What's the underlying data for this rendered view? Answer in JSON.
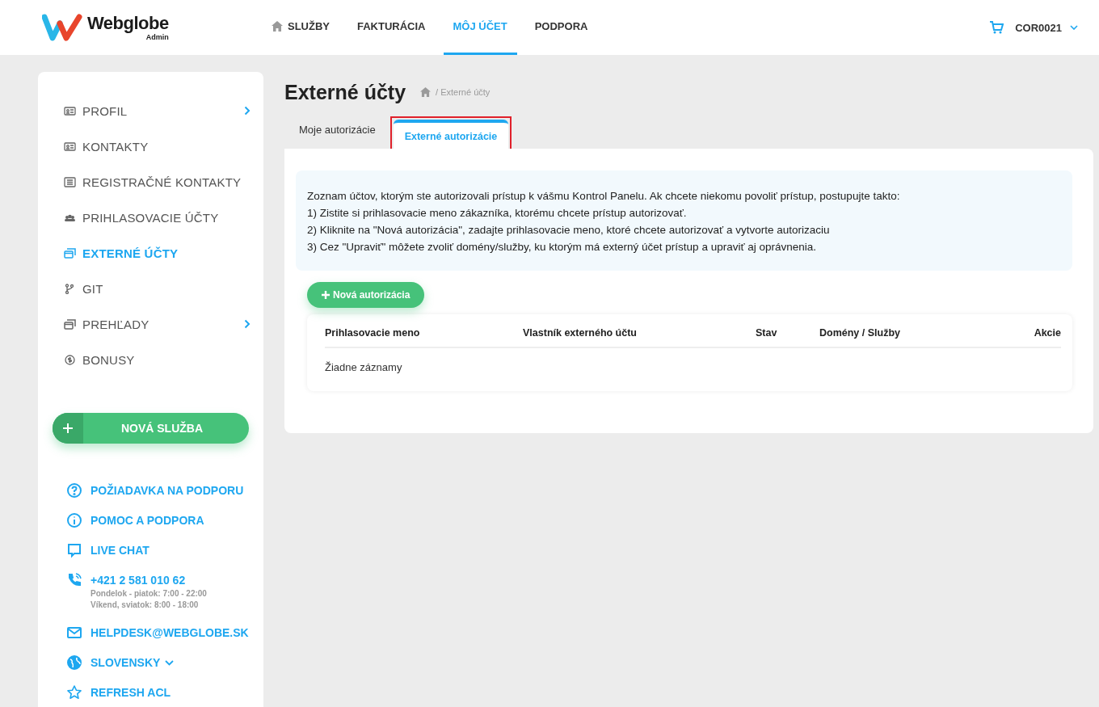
{
  "header": {
    "logo": "Webglobe",
    "logo_sub": "Admin",
    "nav": [
      {
        "label": "SLUŽBY",
        "selected": false
      },
      {
        "label": "FAKTURÁCIA",
        "selected": false
      },
      {
        "label": "MÔJ ÚČET",
        "selected": true
      },
      {
        "label": "PODPORA",
        "selected": false
      }
    ],
    "account": "COR0021"
  },
  "sidebar": {
    "items": [
      {
        "label": "PROFIL",
        "selected": false,
        "has_submenu": true
      },
      {
        "label": "KONTAKTY",
        "selected": false,
        "has_submenu": false
      },
      {
        "label": "REGISTRAČNÉ KONTAKTY",
        "selected": false,
        "has_submenu": false
      },
      {
        "label": "PRIHLASOVACIE ÚČTY",
        "selected": false,
        "has_submenu": false
      },
      {
        "label": "EXTERNÉ ÚČTY",
        "selected": true,
        "has_submenu": false
      },
      {
        "label": "GIT",
        "selected": false,
        "has_submenu": false
      },
      {
        "label": "PREHĽADY",
        "selected": false,
        "has_submenu": true
      },
      {
        "label": "BONUSY",
        "selected": false,
        "has_submenu": false
      }
    ],
    "new_service": "NOVÁ SLUŽBA",
    "links": [
      {
        "kind": "question",
        "label": "POŽIADAVKA NA PODPORU"
      },
      {
        "kind": "info",
        "label": "POMOC A PODPORA"
      },
      {
        "kind": "chat",
        "label": "LIVE CHAT"
      },
      {
        "kind": "phone",
        "label": "+421 2 581 010 62",
        "notes": [
          "Pondelok - piatok: 7:00 - 22:00",
          "Víkend, sviatok: 8:00 - 18:00"
        ]
      },
      {
        "kind": "mail",
        "label": "HELPDESK@WEBGLOBE.SK"
      },
      {
        "kind": "language",
        "label": "SLOVENSKY"
      },
      {
        "kind": "star",
        "label": "REFRESH ACL"
      }
    ]
  },
  "page": {
    "title": "Externé účty",
    "breadcrumb": "/ Externé účty",
    "tabs": [
      {
        "label": "Moje autorizácie",
        "selected": false,
        "outlined": false
      },
      {
        "label": "Externé autorizácie",
        "selected": true,
        "outlined": true
      }
    ],
    "info_lines": [
      "Zoznam účtov, ktorým ste autorizovali prístup k vášmu Kontrol Panelu. Ak chcete niekomu povoliť prístup, postupujte takto:",
      "1) Zistite si prihlasovacie meno zákazníka, ktorému chcete prístup autorizovať.",
      "2) Kliknite na \"Nová autorizácia\", zadajte prihlasovacie meno, ktoré chcete autorizovať a vytvorte autorizaciu",
      "3) Cez \"Upraviť\" môžete zvoliť domény/služby, ku ktorým má externý účet prístup a upraviť aj oprávnenia."
    ],
    "add_button": "Nová autorizácia",
    "table": {
      "columns": [
        "Prihlasovacie meno",
        "Vlastník externého účtu",
        "Stav",
        "Domény / Služby",
        "Akcie"
      ],
      "empty": "Žiadne záznamy"
    }
  }
}
